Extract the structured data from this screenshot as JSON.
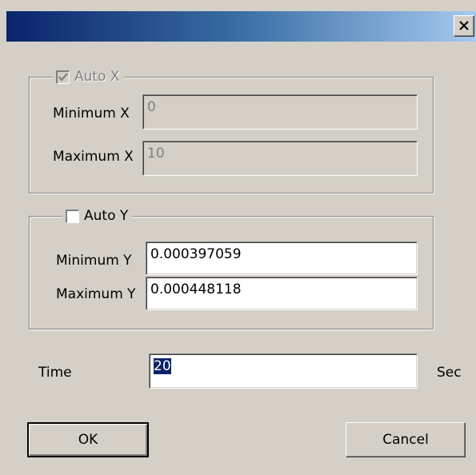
{
  "titlebar": {
    "close_glyph": "✕"
  },
  "group_x": {
    "legend_label": "Auto X",
    "auto_checked": true,
    "min_label": "Minimum X",
    "min_value": "0",
    "max_label": "Maximum X",
    "max_value": "10"
  },
  "group_y": {
    "legend_label": "Auto Y",
    "auto_checked": false,
    "min_label": "Minimum Y",
    "min_value": "0.000397059",
    "max_label": "Maximum Y",
    "max_value": "0.000448118"
  },
  "time": {
    "label": "Time",
    "value": "20",
    "unit": "Sec"
  },
  "buttons": {
    "ok_label": "OK",
    "cancel_label": "Cancel"
  },
  "colors": {
    "titlebar_start": "#0a246a",
    "titlebar_end": "#a6caf0",
    "dialog_bg": "#d4d0c8",
    "selection": "#0a246a"
  }
}
